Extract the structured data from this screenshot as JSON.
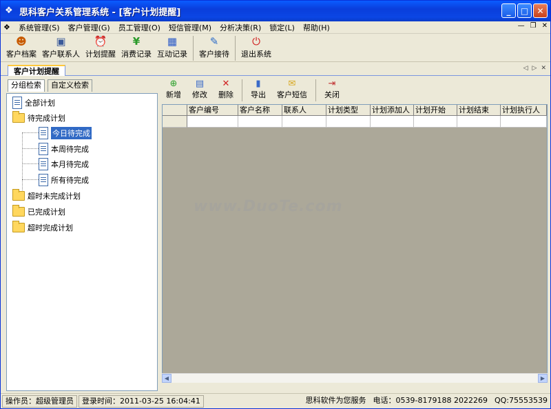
{
  "window": {
    "title": "思科客户关系管理系统 - [客户计划提醒]"
  },
  "menu": [
    "系统管理(S)",
    "客户管理(G)",
    "员工管理(O)",
    "短信管理(M)",
    "分析决策(R)",
    "锁定(L)",
    "帮助(H)"
  ],
  "toolbar": [
    {
      "label": "客户档案",
      "icon": "customers-icon"
    },
    {
      "label": "客户联系人",
      "icon": "contact-icon"
    },
    {
      "label": "计划提醒",
      "icon": "alarm-clock-icon"
    },
    {
      "label": "消费记录",
      "icon": "yen-icon"
    },
    {
      "label": "互动记录",
      "icon": "calendar-icon"
    },
    {
      "label": "客户接待",
      "icon": "notebook-icon"
    },
    {
      "label": "退出系统",
      "icon": "power-icon"
    }
  ],
  "doc_tab": "客户计划提醒",
  "left_tabs": [
    "分组检索",
    "自定义检索"
  ],
  "tree": {
    "all": "全部计划",
    "pending": "待完成计划",
    "today": "今日待完成",
    "week": "本周待完成",
    "month": "本月待完成",
    "allpending": "所有待完成",
    "overdue": "超时未完成计划",
    "done": "已完成计划",
    "overdone": "超时完成计划"
  },
  "right_toolbar": [
    {
      "label": "新增",
      "icon": "add-icon"
    },
    {
      "label": "修改",
      "icon": "edit-icon"
    },
    {
      "label": "删除",
      "icon": "delete-icon"
    },
    {
      "label": "导出",
      "icon": "export-icon"
    },
    {
      "label": "客户短信",
      "icon": "sms-icon"
    },
    {
      "label": "关闭",
      "icon": "exit-icon"
    }
  ],
  "grid": {
    "columns": [
      "客户编号",
      "客户名称",
      "联系人",
      "计划类型",
      "计划添加人",
      "计划开始",
      "计划结束",
      "计划执行人"
    ]
  },
  "status": {
    "operator": "操作员：超级管理员",
    "login": "登录时间：2011-03-25 16:04:41",
    "company": "思科软件为您服务",
    "phone": "电话：0539-8179188 2022269",
    "qq": "QQ:75553539"
  },
  "watermark": "www.DuoTe.com"
}
